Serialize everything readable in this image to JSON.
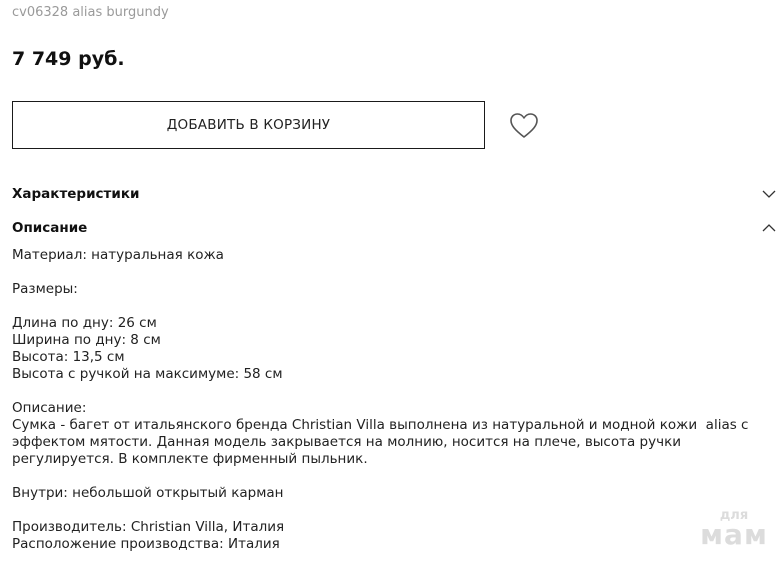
{
  "product": {
    "sku": "cv06328 alias burgundy",
    "price": "7 749 руб."
  },
  "actions": {
    "add_to_cart_label": "ДОБАВИТЬ В КОРЗИНУ",
    "favorite_icon": "heart-outline"
  },
  "sections": {
    "characteristics": {
      "label": "Характеристики",
      "expanded": false
    },
    "description": {
      "label": "Описание",
      "expanded": true
    }
  },
  "description": {
    "material": "Материал: натуральная кожа",
    "sizes_title": "Размеры:",
    "length": "Длина по дну: 26 см",
    "width": "Ширина по дну: 8 см",
    "height": "Высота: 13,5 см",
    "handle_height": "Высота с ручкой на максимуме: 58 см",
    "desc_title": "Описание:",
    "desc_text": "Сумка - багет от итальянского бренда Christian Villa выполнена из натуральной и модной кожи  alias с эффектом мятости. Данная модель закрывается на молнию, носится на плече, высота ручки регулируется. В комплекте фирменный пыльник.",
    "inside": "Внутри: небольшой открытый карман",
    "manufacturer": "Производитель: Christian Villa, Италия",
    "production_location": "Расположение производства: Италия"
  },
  "watermark": {
    "line1": "для",
    "line2": "мам"
  },
  "colors": {
    "text": "#1a1a1a",
    "muted": "#9a9a9a",
    "border": "#1a1a1a",
    "watermark": "#dcdcdc"
  }
}
